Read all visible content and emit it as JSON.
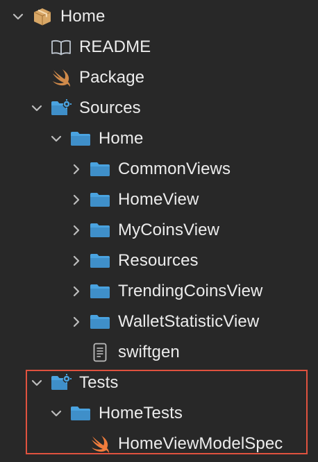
{
  "tree": {
    "nodes": [
      {
        "label": "Home",
        "icon": "package-icon",
        "chevron": "down"
      },
      {
        "label": "README",
        "icon": "book-icon",
        "chevron": "none"
      },
      {
        "label": "Package",
        "icon": "swift-icon",
        "chevron": "none"
      },
      {
        "label": "Sources",
        "icon": "folder-gear-icon",
        "chevron": "down"
      },
      {
        "label": "Home",
        "icon": "folder-icon",
        "chevron": "down"
      },
      {
        "label": "CommonViews",
        "icon": "folder-icon",
        "chevron": "right"
      },
      {
        "label": "HomeView",
        "icon": "folder-icon",
        "chevron": "right"
      },
      {
        "label": "MyCoinsView",
        "icon": "folder-icon",
        "chevron": "right"
      },
      {
        "label": "Resources",
        "icon": "folder-icon",
        "chevron": "right"
      },
      {
        "label": "TrendingCoinsView",
        "icon": "folder-icon",
        "chevron": "right"
      },
      {
        "label": "WalletStatisticView",
        "icon": "folder-icon",
        "chevron": "right"
      },
      {
        "label": "swiftgen",
        "icon": "document-icon",
        "chevron": "none"
      },
      {
        "label": "Tests",
        "icon": "folder-gear-icon",
        "chevron": "down"
      },
      {
        "label": "HomeTests",
        "icon": "folder-icon",
        "chevron": "down"
      },
      {
        "label": "HomeViewModelSpec",
        "icon": "swift-icon",
        "chevron": "none"
      }
    ]
  },
  "colors": {
    "background": "#282828",
    "text": "#ececec",
    "folder": "#4aa3e0",
    "swift": "#f07c3c",
    "package": "#d8a766",
    "highlight": "#e0523f"
  }
}
